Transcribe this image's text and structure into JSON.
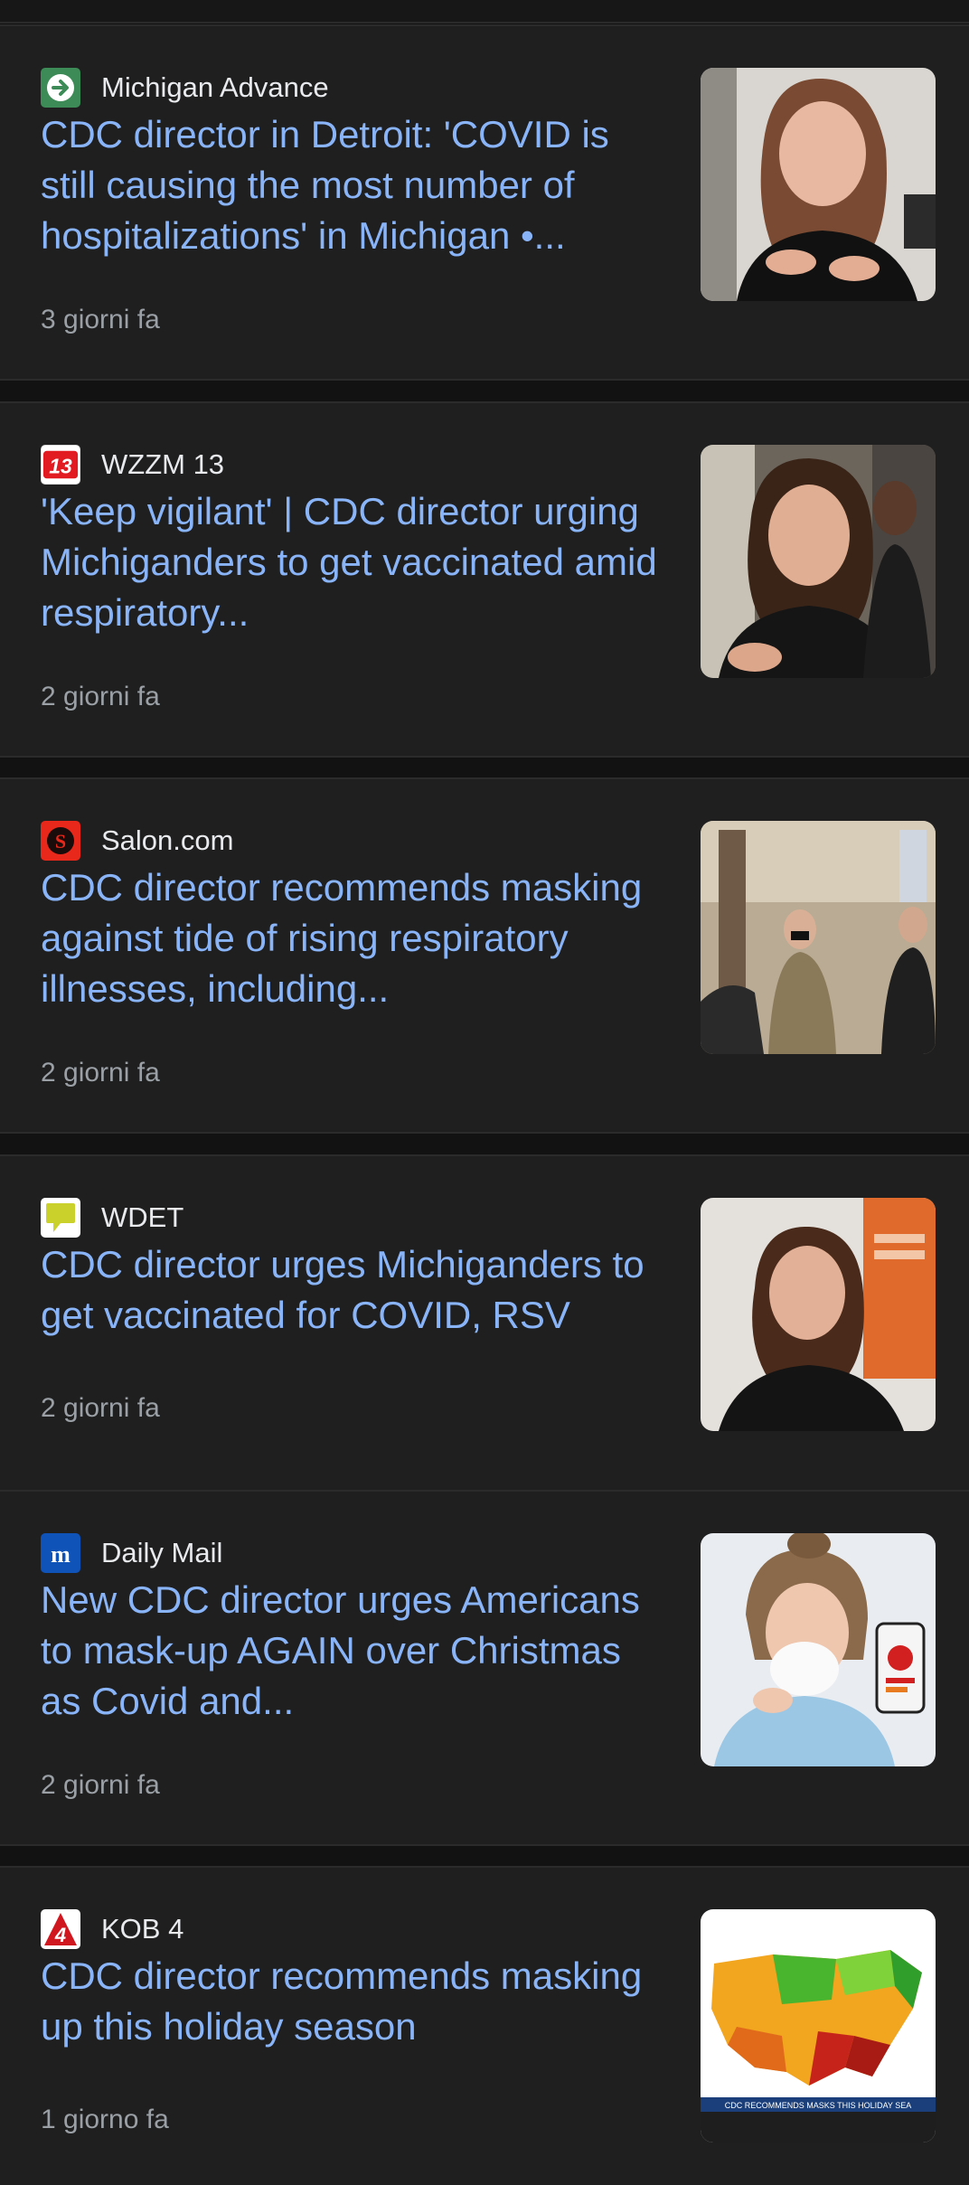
{
  "articles": [
    {
      "source": "Michigan Advance",
      "favicon_icon": "arrow-right-icon",
      "favicon_bg": "#3d8b57",
      "headline": "CDC director in Detroit: 'COVID is still causing the most number of hospitalizations' in Michigan •...",
      "time": "3 giorni fa"
    },
    {
      "source": "WZZM 13",
      "favicon_icon": "wzzm-13-logo",
      "favicon_bg": "#ffffff",
      "headline": "'Keep vigilant' | CDC director urging Michiganders to get vaccinated amid respiratory...",
      "time": "2 giorni fa"
    },
    {
      "source": "Salon.com",
      "favicon_icon": "salon-s-logo",
      "favicon_bg": "#e8281a",
      "headline": "CDC director recommends masking against tide of rising respiratory illnesses, including...",
      "time": "2 giorni fa"
    },
    {
      "source": "WDET",
      "favicon_icon": "wdet-speech-bubble-logo",
      "favicon_bg": "#ffffff",
      "headline": "CDC director urges Michiganders to get vaccinated for COVID, RSV",
      "time": "2 giorni fa"
    },
    {
      "source": "Daily Mail",
      "favicon_icon": "daily-mail-m-logo",
      "favicon_bg": "#0f53b8",
      "headline": "New CDC director urges Americans to mask-up AGAIN over Christmas as Covid and...",
      "time": "2 giorni fa"
    },
    {
      "source": "KOB 4",
      "favicon_icon": "kob-4-logo",
      "favicon_bg": "#ffffff",
      "headline": "CDC director recommends masking up this holiday season",
      "time": "1 giorno fa",
      "thumb_caption": "CDC RECOMMENDS MASKS THIS HOLIDAY SEA"
    }
  ],
  "colors": {
    "headline": "#8ab4f8",
    "meta": "#9aa0a6",
    "card_bg": "#1f1f1f",
    "page_bg": "#121212"
  }
}
